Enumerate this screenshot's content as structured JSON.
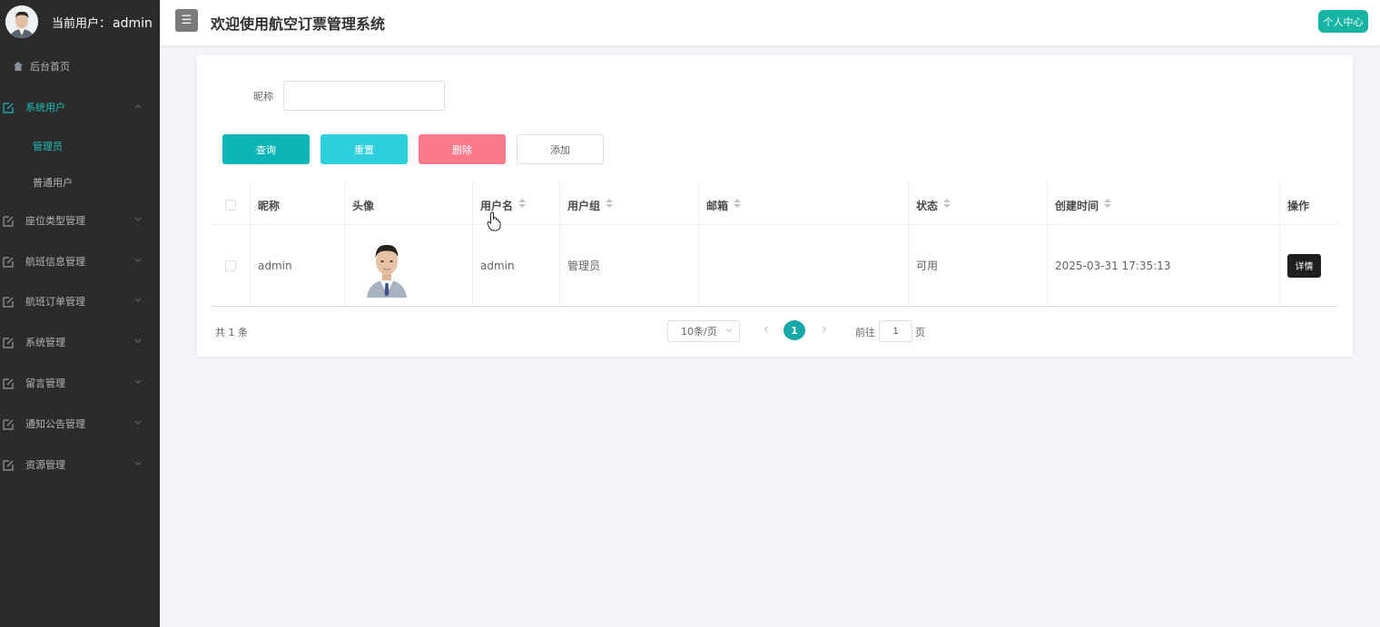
{
  "sidebar": {
    "current_user_label": "当前用户：",
    "current_user": "admin",
    "home": "后台首页",
    "menus": [
      {
        "label": "系统用户",
        "children": [
          "管理员",
          "普通用户"
        ]
      },
      {
        "label": "座位类型管理"
      },
      {
        "label": "航班信息管理"
      },
      {
        "label": "航班订单管理"
      },
      {
        "label": "系统管理"
      },
      {
        "label": "留言管理"
      },
      {
        "label": "通知公告管理"
      },
      {
        "label": "资源管理"
      }
    ]
  },
  "header": {
    "menu_icon": "☰",
    "title": "欢迎使用航空订票管理系统",
    "profile_button": "个人中心"
  },
  "search": {
    "label": "昵称",
    "value": "",
    "placeholder": ""
  },
  "buttons": {
    "query": "查询",
    "reset": "重置",
    "delete": "删除",
    "add": "添加"
  },
  "table": {
    "columns": [
      "昵称",
      "头像",
      "用户名",
      "用户组",
      "邮箱",
      "状态",
      "创建时间",
      "操作"
    ],
    "rows": [
      {
        "nickname": "admin",
        "username": "admin",
        "group": "管理员",
        "email": "",
        "status": "可用",
        "created": "2025-03-31 17:35:13",
        "action": "详情"
      }
    ]
  },
  "pagination": {
    "total": "共 1 条",
    "page_size": "10条/页",
    "current_page": "1",
    "goto_label": "前往",
    "goto_value": "1",
    "goto_suffix": "页"
  }
}
